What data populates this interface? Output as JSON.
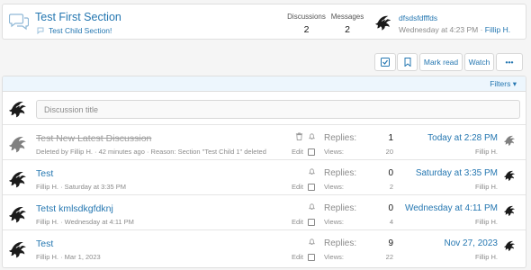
{
  "node": {
    "title": "Test First Section",
    "subforum": "Test Child Section!",
    "discussions_label": "Discussions",
    "discussions_value": "2",
    "messages_label": "Messages",
    "messages_value": "2",
    "last_post_title": "dfsdsfdfffds",
    "last_post_time": "Wednesday at 4:23 PM",
    "last_post_sep": " · ",
    "last_post_user": "Fillip H."
  },
  "toolbar": {
    "check_icon": "check-square-icon",
    "bookmark_icon": "bookmark-icon",
    "mark_read": "Mark read",
    "watch": "Watch",
    "more": "•••"
  },
  "list": {
    "filters_label": "Filters",
    "quick_placeholder": "Discussion title"
  },
  "threads": [
    {
      "title": "Test New Latest Discussion",
      "meta": "Deleted by Fillip H. · 42 minutes ago · Reason: Section \"Test Child 1\" deleted",
      "edit": "Edit",
      "replies_label": "Replies:",
      "replies": "1",
      "views_label": "Views:",
      "views": "20",
      "last_date": "Today at 2:28 PM",
      "last_user": "Fillip H.",
      "deleted": true
    },
    {
      "title": "Test",
      "meta": "Fillip H. · Saturday at 3:35 PM",
      "edit": "Edit",
      "replies_label": "Replies:",
      "replies": "0",
      "views_label": "Views:",
      "views": "2",
      "last_date": "Saturday at 3:35 PM",
      "last_user": "Fillip H.",
      "deleted": false
    },
    {
      "title": "Tetst kmlsdkgfdknj",
      "meta": "Fillip H. · Wednesday at 4:11 PM",
      "edit": "Edit",
      "replies_label": "Replies:",
      "replies": "0",
      "views_label": "Views:",
      "views": "4",
      "last_date": "Wednesday at 4:11 PM",
      "last_user": "Fillip H.",
      "deleted": false
    },
    {
      "title": "Test",
      "meta": "Fillip H. · Mar 1, 2023",
      "edit": "Edit",
      "replies_label": "Replies:",
      "replies": "9",
      "views_label": "Views:",
      "views": "22",
      "last_date": "Nov 27, 2023",
      "last_user": "Fillip H.",
      "deleted": false
    }
  ],
  "colors": {
    "link": "#2577b1",
    "muted": "#8c8c8c",
    "filter_bar": "#edf6fd"
  }
}
